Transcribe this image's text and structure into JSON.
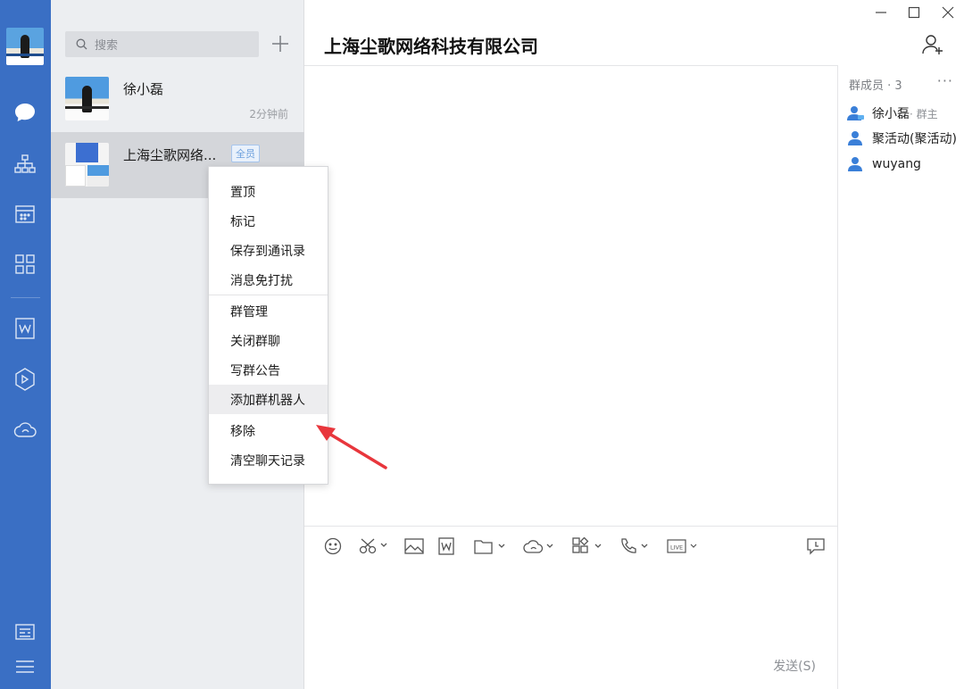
{
  "window": {
    "minimize_icon": "minimize-icon",
    "maximize_icon": "maximize-icon",
    "close_icon": "close-icon"
  },
  "rail": {
    "items": [
      {
        "name": "messages",
        "icon": "chat-bubble-icon"
      },
      {
        "name": "contacts",
        "icon": "org-chart-icon"
      },
      {
        "name": "calendar",
        "icon": "calendar-icon"
      },
      {
        "name": "workbench",
        "icon": "grid-apps-icon"
      },
      {
        "name": "documents",
        "icon": "doc-w-icon"
      },
      {
        "name": "cube",
        "icon": "cube-icon"
      },
      {
        "name": "cloud",
        "icon": "cloud-icon"
      },
      {
        "name": "notes",
        "icon": "notes-icon"
      },
      {
        "name": "menu",
        "icon": "hamburger-icon"
      }
    ]
  },
  "search": {
    "placeholder": "搜索"
  },
  "sessions": [
    {
      "name": "徐小磊",
      "time": "2分钟前"
    },
    {
      "name": "上海尘歌网络...",
      "badge": "全员"
    }
  ],
  "chat": {
    "title": "上海尘歌网络科技有限公司",
    "send_label": "发送(S)"
  },
  "members": {
    "title": "群成员 · 3",
    "more": "···",
    "list": [
      {
        "name": "徐小磊",
        "role": "· 群主"
      },
      {
        "name": "聚活动(聚活动)",
        "role": ""
      },
      {
        "name": "wuyang",
        "role": ""
      }
    ]
  },
  "context_menu": {
    "group1": [
      "置顶",
      "标记",
      "保存到通讯录",
      "消息免打扰"
    ],
    "group2": [
      "群管理",
      "关闭群聊",
      "写群公告",
      "添加群机器人",
      "移除",
      "清空聊天记录"
    ],
    "highlighted": "添加群机器人"
  },
  "colors": {
    "rail": "#3a6fc4",
    "accent": "#3c78d8",
    "arrow": "#e8363c"
  }
}
